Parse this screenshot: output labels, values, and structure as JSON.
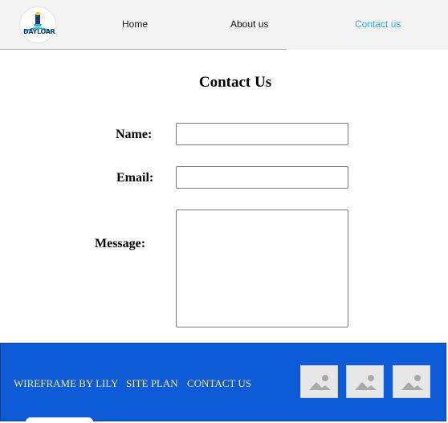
{
  "header": {
    "logo_text": "DAYLOAR",
    "nav": [
      {
        "label": "Home",
        "active": false
      },
      {
        "label": "About us",
        "active": false
      },
      {
        "label": "Contact  us",
        "active": true
      }
    ],
    "active_color": "#2bb3d8"
  },
  "main": {
    "title": "Contact Us",
    "fields": {
      "name_label": "Name:",
      "name_value": "",
      "email_label": "Email:",
      "email_value": "",
      "message_label": "Message:",
      "message_value": ""
    }
  },
  "footer": {
    "background": "#0d5bd6",
    "link_color": "#f3e98a",
    "links": [
      "WIREFRAME BY LILY",
      "SITE PLAN",
      "CONTACT US"
    ],
    "thumbnails": [
      "image-placeholder-icon",
      "image-placeholder-icon",
      "image-placeholder-icon"
    ]
  }
}
